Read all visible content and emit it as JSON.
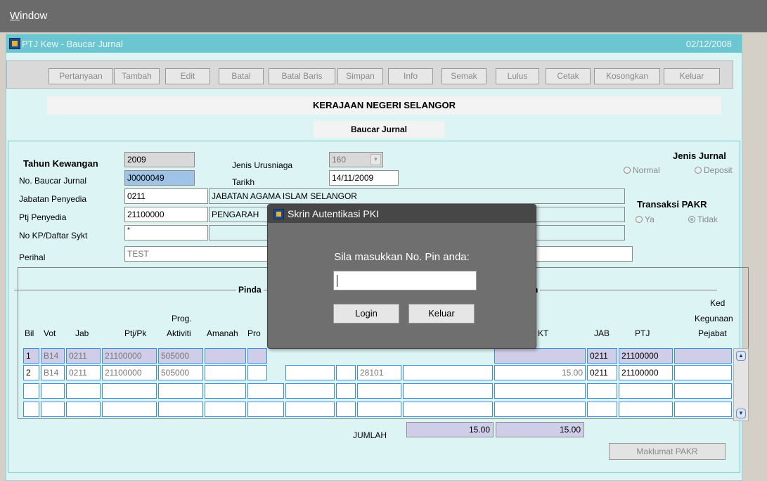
{
  "menubar": {
    "first_letter": "W",
    "rest": "indow"
  },
  "window": {
    "title": "PTJ Kew - Baucar Jurnal",
    "date": "02/12/2008"
  },
  "toolbar": {
    "buttons": [
      "Pertanyaan",
      "Tambah",
      "Edit",
      "Batal",
      "Batal Baris",
      "Simpan",
      "Info",
      "Semak",
      "Lulus",
      "Cetak",
      "Kosongkan",
      "Keluar"
    ]
  },
  "banner": {
    "org": "KERAJAAN NEGERI SELANGOR",
    "form": "Baucar Jurnal"
  },
  "form": {
    "tahun_label": "Tahun Kewangan",
    "tahun": "2009",
    "no_label": "No. Baucar Jurnal",
    "no": "J0000049",
    "jenis_label": "Jenis Urusniaga",
    "jenis": "160",
    "tarikh_label": "Tarikh",
    "tarikh": "14/11/2009",
    "jabatan_label": "Jabatan Penyedia",
    "jabatan_kod": "0211",
    "jabatan_nama": "JABATAN AGAMA ISLAM SELANGOR",
    "ptj_label": "Ptj Penyedia",
    "ptj_kod": "21100000",
    "ptj_nama": "PENGARAH",
    "kp_label": "No KP/Daftar Sykt",
    "kp": "*",
    "perihal_label": "Perihal",
    "perihal": "TEST"
  },
  "jenis_jurnal": {
    "label": "Jenis Jurnal",
    "opt1": "Normal",
    "opt2": "Deposit"
  },
  "pakr": {
    "label": "Transaksi PAKR",
    "opt1": "Ya",
    "opt2": "Tidak"
  },
  "sections": {
    "left": "Pinda",
    "right": "h"
  },
  "grid": {
    "headers": {
      "bil": "Bil",
      "vot": "Vot",
      "jab": "Jab",
      "ptj": "Ptj/Pk",
      "prog1": "Prog.",
      "prog2": "Aktiviti",
      "amanah": "Amanah",
      "pro": "Pro",
      "kt": "KT",
      "jab2": "JAB",
      "ptj2": "PTJ",
      "ked1": "Ked",
      "ked2": "Kegunaan",
      "ked3": "Pejabat"
    },
    "rows": [
      {
        "bil": "1",
        "vot": "B14",
        "jab": "0211",
        "ptj": "21100000",
        "prog": "505000",
        "kod": "",
        "amt": "",
        "jab2": "0211",
        "ptj2": "21100000"
      },
      {
        "bil": "2",
        "vot": "B14",
        "jab": "0211",
        "ptj": "21100000",
        "prog": "505000",
        "kod": "28101",
        "amt": "15.00",
        "jab2": "0211",
        "ptj2": "21100000"
      }
    ],
    "jumlah_label": "JUMLAH",
    "jumlah_debit": "15.00",
    "jumlah_kredit": "15.00"
  },
  "maklumat_btn": "Maklumat PAKR",
  "dialog": {
    "title": "Skrin Autentikasi PKI",
    "message": "Sila masukkan No. Pin anda:",
    "pin_value": "",
    "login": "Login",
    "keluar": "Keluar"
  }
}
